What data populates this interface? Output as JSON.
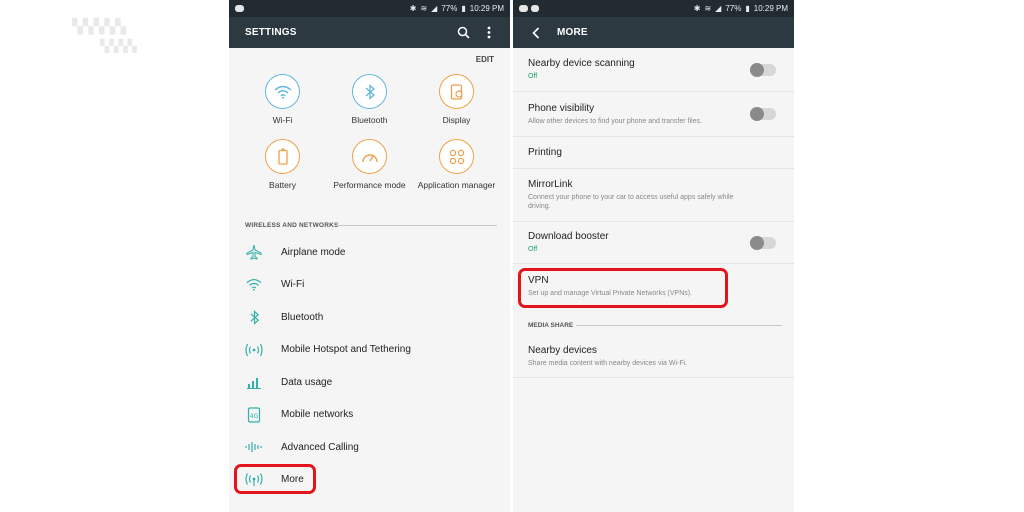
{
  "left": {
    "status": {
      "battery": "77%",
      "time": "10:29 PM"
    },
    "appbar": {
      "title": "SETTINGS",
      "search_icon": "search-icon",
      "menu_icon": "more-vert-icon"
    },
    "edit_label": "EDIT",
    "quick_settings": [
      {
        "label": "Wi-Fi",
        "icon": "wifi-icon",
        "accent": "#63b6dc"
      },
      {
        "label": "Bluetooth",
        "icon": "bluetooth-icon",
        "accent": "#63b6dc"
      },
      {
        "label": "Display",
        "icon": "display-icon",
        "accent": "#f0a04a"
      },
      {
        "label": "Battery",
        "icon": "battery-icon",
        "accent": "#f0a04a"
      },
      {
        "label": "Performance mode",
        "icon": "gauge-icon",
        "accent": "#f0a04a"
      },
      {
        "label": "Application manager",
        "icon": "apps-icon",
        "accent": "#f0a04a"
      }
    ],
    "section_title": "WIRELESS AND NETWORKS",
    "menu": [
      {
        "label": "Airplane mode",
        "icon": "airplane-icon"
      },
      {
        "label": "Wi-Fi",
        "icon": "wifi-icon"
      },
      {
        "label": "Bluetooth",
        "icon": "bluetooth-icon"
      },
      {
        "label": "Mobile Hotspot and Tethering",
        "icon": "hotspot-icon"
      },
      {
        "label": "Data usage",
        "icon": "data-usage-icon"
      },
      {
        "label": "Mobile networks",
        "icon": "mobile-networks-icon"
      },
      {
        "label": "Advanced Calling",
        "icon": "advanced-calling-icon"
      },
      {
        "label": "More",
        "icon": "more-connections-icon"
      }
    ],
    "icon_color": "#33b0a8"
  },
  "right": {
    "status": {
      "battery": "77%",
      "time": "10:29 PM"
    },
    "appbar": {
      "title": "MORE",
      "back_icon": "back-arrow-icon"
    },
    "items": [
      {
        "title": "Nearby device scanning",
        "subtitle": "Off",
        "subtitle_green": true,
        "toggle": true
      },
      {
        "title": "Phone visibility",
        "subtitle": "Allow other devices to find your phone and transfer files.",
        "subtitle_green": false,
        "toggle": true
      },
      {
        "title": "Printing",
        "subtitle": "",
        "subtitle_green": false,
        "toggle": false
      },
      {
        "title": "MirrorLink",
        "subtitle": "Connect your phone to your car to access useful apps safely while driving.",
        "subtitle_green": false,
        "toggle": false
      },
      {
        "title": "Download booster",
        "subtitle": "Off",
        "subtitle_green": true,
        "toggle": true
      },
      {
        "title": "VPN",
        "subtitle": "Set up and manage Virtual Private Networks (VPNs).",
        "subtitle_green": false,
        "toggle": false
      }
    ],
    "section_title": "MEDIA SHARE",
    "media_items": [
      {
        "title": "Nearby devices",
        "subtitle": "Share media content with nearby devices via Wi-Fi."
      }
    ],
    "highlight_color": "#e3141c"
  }
}
